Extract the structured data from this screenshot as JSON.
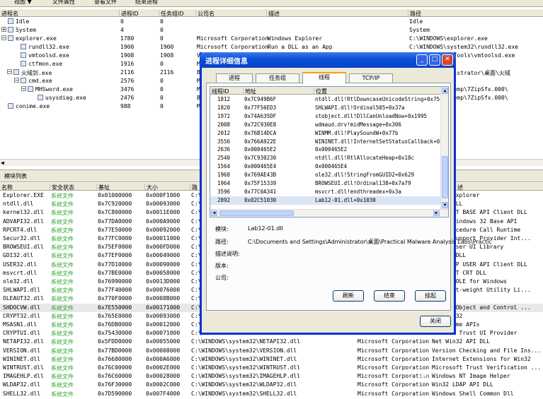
{
  "toolbar": {
    "items": [
      "视图 ▼",
      "文件属性",
      "查看文件",
      "结束进程"
    ]
  },
  "process_pane": {
    "columns": [
      "进程名",
      "进程ID",
      "任务组ID",
      "公司名",
      "描述",
      "路径"
    ],
    "rows": [
      {
        "name": "Idle",
        "pid": "0",
        "gid": "0",
        "company": "",
        "desc": "",
        "path": "Idle"
      },
      {
        "name": "System",
        "pid": "4",
        "gid": "0",
        "company": "",
        "desc": "",
        "path": "System"
      },
      {
        "name": "explorer.exe",
        "pid": "1780",
        "gid": "0",
        "company": "Microsoft Corporation",
        "desc": "Windows Explorer",
        "path": "C:\\WINDOWS\\explorer.exe"
      },
      {
        "name": "rundll32.exe",
        "pid": "1900",
        "gid": "1900",
        "company": "Microsoft Corporation",
        "desc": "Run a DLL as an App",
        "path": "C:\\WINDOWS\\system32\\rundll32.exe"
      },
      {
        "name": "vmtoolsd.exe",
        "pid": "1908",
        "gid": "1908",
        "company": "V",
        "desc": "",
        "path": "Mware\\VMware Tools\\vmtoolsd.exe"
      },
      {
        "name": "ctfmon.exe",
        "pid": "1916",
        "gid": "0",
        "company": "M",
        "desc": "",
        "path": "2\\ctfmon.exe"
      },
      {
        "name": "火绒剑.exe",
        "pid": "2116",
        "gid": "2116",
        "company": "B",
        "desc": "",
        "path": "ettings\\Administrator\\桌面\\火绒"
      },
      {
        "name": "cmd.exe",
        "pid": "2576",
        "gid": "0",
        "company": "M",
        "desc": "",
        "path": "2\\cmd.exe"
      },
      {
        "name": "MHSword.exe",
        "pid": "3476",
        "gid": "0",
        "company": "M",
        "desc": "",
        "path": "~1\\LOCALS~1\\Temp\\7ZipSfx.000\\"
      },
      {
        "name": "usysdiag.exe",
        "pid": "2476",
        "gid": "0",
        "company": "B",
        "desc": "",
        "path": "~1\\LOCALS~1\\Temp\\7ZipSfx.000\\"
      },
      {
        "name": "conime.exe",
        "pid": "988",
        "gid": "0",
        "company": "M",
        "desc": "",
        "path": "2\\conime.exe"
      }
    ]
  },
  "module_pane": {
    "title": "模块列表",
    "columns": [
      "名称",
      "安全状态",
      "基址",
      "大小",
      "路",
      "述"
    ],
    "rows": [
      {
        "name": "Explorer.EXE",
        "status": "系统文件",
        "base": "0x01000000",
        "size": "0x000F1000",
        "path": "C:\\",
        "company": "",
        "desc": "ndows Explorer"
      },
      {
        "name": "ntdll.dll",
        "status": "系统文件",
        "base": "0x7C920000",
        "size": "0x00093000",
        "path": "C:\\",
        "company": "",
        "desc": "Layer DLL"
      },
      {
        "name": "kernel32.dll",
        "status": "系统文件",
        "base": "0x7C800000",
        "size": "0x0011E000",
        "path": "C:\\",
        "company": "",
        "desc": "ndows NT BASE API Client DLL"
      },
      {
        "name": "ADVAPI32.dll",
        "status": "系统文件",
        "base": "0x77DA0000",
        "size": "0x000A9000",
        "path": "C:\\",
        "company": "",
        "desc": "anced Windows 32 Base API"
      },
      {
        "name": "RPCRT4.dll",
        "status": "系统文件",
        "base": "0x77E50000",
        "size": "0x00092000",
        "path": "C:\\",
        "company": "",
        "desc": "ote Procedure Call Runtime"
      },
      {
        "name": "Secur32.dll",
        "status": "系统文件",
        "base": "0x77FC0000",
        "size": "0x00011000",
        "path": "C:\\",
        "company": "",
        "desc": "urity Support Provider Int..."
      },
      {
        "name": "BROWSEUI.dll",
        "status": "系统文件",
        "base": "0x75EF0000",
        "size": "0x000FD000",
        "path": "C:\\",
        "company": "",
        "desc": "ll Browser UI Library"
      },
      {
        "name": "GDI32.dll",
        "status": "系统文件",
        "base": "0x77EF0000",
        "size": "0x00049000",
        "path": "C:\\",
        "company": "",
        "desc": "Client DLL"
      },
      {
        "name": "USER32.dll",
        "status": "系统文件",
        "base": "0x77D10000",
        "size": "0x00090000",
        "path": "C:\\",
        "company": "",
        "desc": "ndows XP USER API Client DLL"
      },
      {
        "name": "msvcrt.dll",
        "status": "系统文件",
        "base": "0x77BE0000",
        "size": "0x00058000",
        "path": "C:\\",
        "company": "",
        "desc": "ndows NT CRT DLL"
      },
      {
        "name": "ole32.dll",
        "status": "系统文件",
        "base": "0x76990000",
        "size": "0x0013D000",
        "path": "C:\\",
        "company": "",
        "desc": "rosoft OLE for Windows"
      },
      {
        "name": "SHLWAPI.dll",
        "status": "系统文件",
        "base": "0x77F40000",
        "size": "0x00076000",
        "path": "C:\\",
        "company": "",
        "desc": "ll Light-weight Utility Li..."
      },
      {
        "name": "OLEAUT32.dll",
        "status": "系统文件",
        "base": "0x770F0000",
        "size": "0x0008B000",
        "path": "C:\\",
        "company": "",
        "desc": ""
      },
      {
        "name": "SHDOCVW.dll",
        "status": "系统文件",
        "base": "0x7E550000",
        "size": "0x00171000",
        "path": "C:\\",
        "company": "",
        "desc": "ll Doc Object and Control ..."
      },
      {
        "name": "CRYPT32.dll",
        "status": "系统文件",
        "base": "0x765E0000",
        "size": "0x00093000",
        "path": "C:\\",
        "company": "",
        "desc": "pto API32"
      },
      {
        "name": "MSASN1.dll",
        "status": "系统文件",
        "base": "0x76DB0000",
        "size": "0x00012000",
        "path": "C:\\",
        "company": "",
        "desc": "1 Runtime APIs"
      },
      {
        "name": "CRYPTUI.dll",
        "status": "系统文件",
        "base": "0x75430000",
        "size": "0x00071000",
        "path": "C:\\",
        "company": "",
        "desc": "crosoft Trust UI Provider"
      },
      {
        "name": "NETAPI32.dll",
        "status": "系统文件",
        "base": "0x5FDD0000",
        "size": "0x00055000",
        "path": "C:\\WINDOWS\\system32\\NETAPI32.dll",
        "company": "Microsoft Corporation",
        "desc": "Net Win32 API DLL"
      },
      {
        "name": "VERSION.dll",
        "status": "系统文件",
        "base": "0x77BD0000",
        "size": "0x00008000",
        "path": "C:\\WINDOWS\\system32\\VERSION.dll",
        "company": "Microsoft Corporation",
        "desc": "Version Checking and File Ins..."
      },
      {
        "name": "WININET.dll",
        "status": "系统文件",
        "base": "0x76680000",
        "size": "0x000A6000",
        "path": "C:\\WINDOWS\\system32\\WININET.dll",
        "company": "Microsoft Corporation",
        "desc": "Internet Extensions for Win32"
      },
      {
        "name": "WINTRUST.dll",
        "status": "系统文件",
        "base": "0x76C00000",
        "size": "0x0002E000",
        "path": "C:\\WINDOWS\\system32\\WINTRUST.dll",
        "company": "Microsoft Corporation",
        "desc": "Microsoft Trust Verification ..."
      },
      {
        "name": "IMAGEHLP.dll",
        "status": "系统文件",
        "base": "0x76C60000",
        "size": "0x00028000",
        "path": "C:\\WINDOWS\\system32\\IMAGEHLP.dll",
        "company": "Microsoft Corporation",
        "desc": "Windows NT Image Helper"
      },
      {
        "name": "WLDAP32.dll",
        "status": "系统文件",
        "base": "0x76F30000",
        "size": "0x0002C000",
        "path": "C:\\WINDOWS\\system32\\WLDAP32.dll",
        "company": "Microsoft Corporation",
        "desc": "Win32 LDAP API DLL"
      },
      {
        "name": "SHELL32.dll",
        "status": "系统文件",
        "base": "0x7D590000",
        "size": "0x007F4000",
        "path": "C:\\WINDOWS\\system32\\SHELL32.dll",
        "company": "Microsoft Corporation",
        "desc": "Windows Shell Common Dll"
      }
    ]
  },
  "dialog": {
    "title": "进程详细信息",
    "tabs": [
      "进程",
      "任务组",
      "线程",
      "TCP/IP"
    ],
    "thread_columns": [
      "线程ID",
      "地址",
      "位置"
    ],
    "threads": [
      {
        "tid": "1812",
        "addr": "0x7C949B6F",
        "loc": "ntdll.dll!RtlDowncaseUnicodeString+0x75"
      },
      {
        "tid": "1820",
        "addr": "0x77F56ED3",
        "loc": "SHLWAPI.dll!Ordinal505+0x37a"
      },
      {
        "tid": "1972",
        "addr": "0x74A635DF",
        "loc": "stobject.dll!DllCanUnloadNow+0x1995"
      },
      {
        "tid": "2008",
        "addr": "0x72C930E8",
        "loc": "wdmaud.drv!midMessage+0x306"
      },
      {
        "tid": "2012",
        "addr": "0x76B14DCA",
        "loc": "WINMM.dll!PlaySoundW+0x77b"
      },
      {
        "tid": "3556",
        "addr": "0x766A922E",
        "loc": "WININET.dll!InternetSetStatusCallback+0x1ca"
      },
      {
        "tid": "2636",
        "addr": "0x000465E2",
        "loc": "0x000465E2"
      },
      {
        "tid": "2540",
        "addr": "0x7C930230",
        "loc": "ntdll.dll!RtlAllocateHeap+0x18c"
      },
      {
        "tid": "1564",
        "addr": "0x000465E4",
        "loc": "0x000465E4"
      },
      {
        "tid": "1968",
        "addr": "0x769AE43B",
        "loc": "ole32.dll!StringFromGUID2+0x629"
      },
      {
        "tid": "1964",
        "addr": "0x75F15339",
        "loc": "BROWSEUI.dll!Ordinal138+0x7a79"
      },
      {
        "tid": "3596",
        "addr": "0x77C0A341",
        "loc": "msvcrt.dll!endthreadex+0x3a"
      },
      {
        "tid": "2892",
        "addr": "0x02C51030",
        "loc": "Lab12-01.dll+0x1030"
      }
    ],
    "details": {
      "module_label": "模块:",
      "module_value": "Lab12-01.dll",
      "path_label": "路径:",
      "path_value": "C:\\Documents and Settings\\Administrator\\桌面\\Practical Malware Analysis Labs\\Practic",
      "desc_label": "描述说明:",
      "version_label": "版本:",
      "company_label": "公司:"
    },
    "buttons": {
      "refresh": "刷新",
      "end": "结束",
      "suspend": "挂起",
      "close": "关闭"
    }
  }
}
